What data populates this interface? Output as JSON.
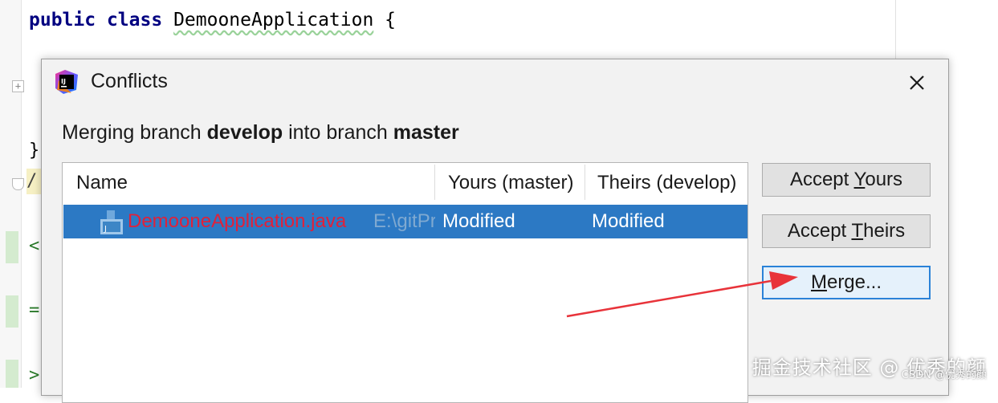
{
  "editor": {
    "code_keyword_public": "public",
    "code_keyword_class": "class",
    "code_classname": "DemooneApplication",
    "code_brace": "{",
    "gutter_chars": [
      "}",
      "/",
      "<",
      "=",
      ">"
    ]
  },
  "dialog": {
    "title": "Conflicts",
    "close_glyph": "✕",
    "desc_prefix": "Merging branch ",
    "desc_branch_from": "develop",
    "desc_middle": " into branch ",
    "desc_branch_to": "master",
    "table": {
      "columns": [
        "Name",
        "Yours (master)",
        "Theirs (develop)"
      ],
      "rows": [
        {
          "file": "DemooneApplication.java",
          "path": "E:\\gitPr",
          "yours": "Modified",
          "theirs": "Modified",
          "selected": true
        }
      ]
    },
    "buttons": {
      "accept_yours_pre": "Accept ",
      "accept_yours_mnemonic": "Y",
      "accept_yours_post": "ours",
      "accept_theirs_pre": "Accept ",
      "accept_theirs_mnemonic": "T",
      "accept_theirs_post": "heirs",
      "merge_pre": "",
      "merge_mnemonic": "M",
      "merge_post": "erge..."
    }
  },
  "colors": {
    "selection": "#2c79c4",
    "conflict_file": "#e0213a",
    "annotation_arrow": "#e8333a",
    "focus_border": "#2a82d8"
  },
  "watermark": {
    "main": "掘金技术社区 @ 优秀的颜",
    "sub": "CSDN @优秀的颜"
  }
}
